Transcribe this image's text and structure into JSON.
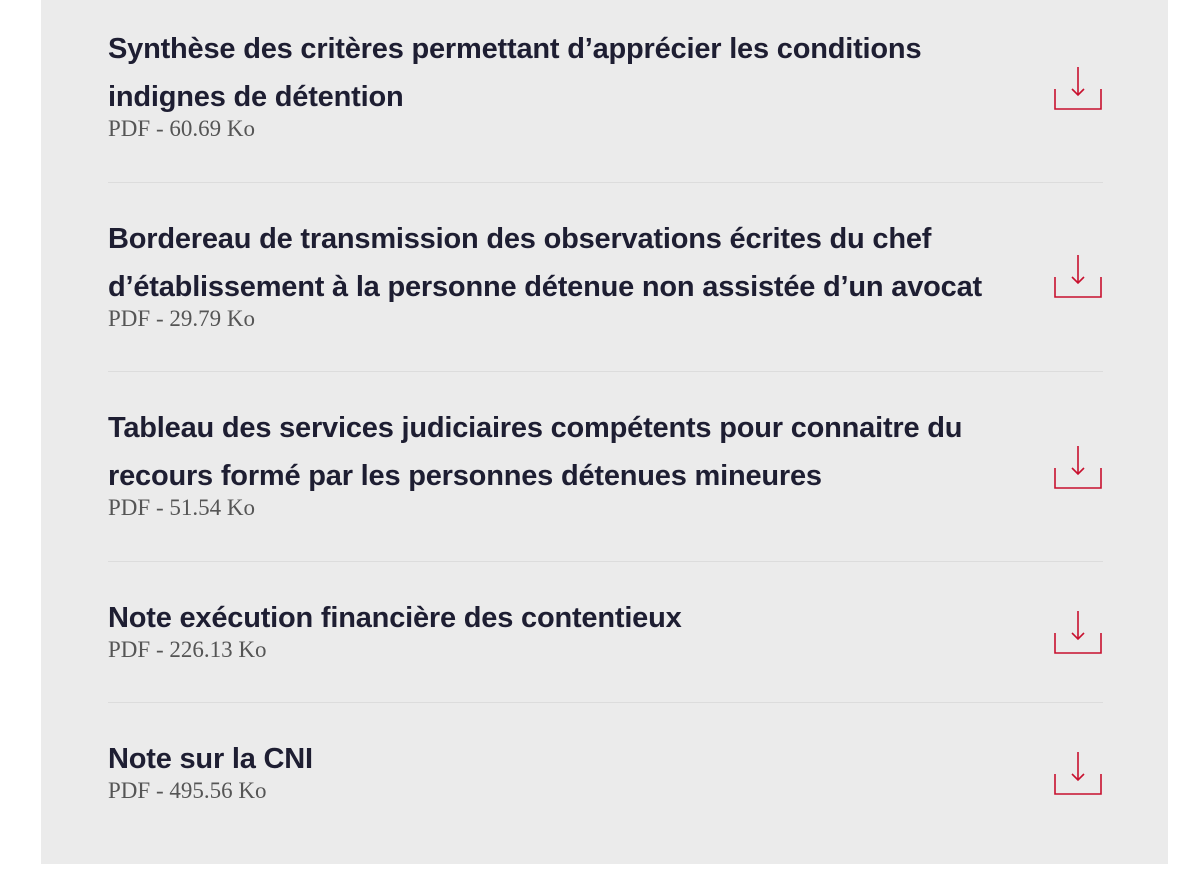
{
  "documents": [
    {
      "title": "Synthèse des critères permettant d’apprécier les conditions indignes de détention",
      "meta": "PDF - 60.69 Ko"
    },
    {
      "title": "Bordereau de transmission des observations écrites du chef d’établissement à la personne détenue non assistée d’un avocat",
      "meta": "PDF - 29.79 Ko"
    },
    {
      "title": "Tableau des services judiciaires compétents pour connaitre du recours formé par les personnes détenues mineures",
      "meta": "PDF - 51.54 Ko"
    },
    {
      "title": "Note exécution financière des contentieux",
      "meta": "PDF - 226.13 Ko"
    },
    {
      "title": "Note sur la CNI",
      "meta": "PDF - 495.56 Ko"
    }
  ],
  "icons": {
    "download": "download-icon"
  },
  "colors": {
    "accent": "#c8102e",
    "title": "#1e1e32",
    "meta": "#555555",
    "panel": "#ebebeb"
  }
}
